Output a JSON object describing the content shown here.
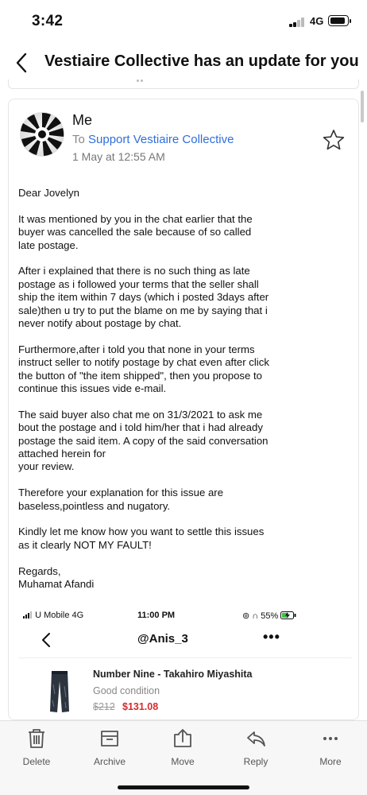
{
  "status_bar": {
    "time": "3:42",
    "network": "4G"
  },
  "header": {
    "title": "Vestiaire Collective has an update for you"
  },
  "email": {
    "sender": "Me",
    "to_prefix": "To",
    "recipient": "Support Vestiaire Collective",
    "date": "1 May at 12:55 AM",
    "paragraphs": [
      "Dear Jovelyn",
      "It was mentioned by you in the chat earlier that the\nbuyer was cancelled the sale because of so called\nlate postage.",
      "After i explained that there is no such thing as late\npostage  as i followed your terms that the seller shall\nship the item within 7 days (which i posted 3days after\nsale)then u try to put the blame on me by saying that i\nnever notify about postage by chat.",
      "Furthermore,after i told you that none in your terms\ninstruct seller to notify postage by chat even after click\nthe button of \"the item shipped\", then you propose to\ncontinue this issues vide e-mail.",
      "The said buyer also chat me on 31/3/2021 to ask me\nbout the postage and i told him/her that i had already\npostage the said item. A copy of the said conversation\nattached herein for\nyour review.",
      "Therefore your explanation for this issue are\nbaseless,pointless and nugatory.",
      "Kindly let me know how you want to settle this issues\nas it clearly NOT MY FAULT!",
      "Regards,\nMuhamat Afandi"
    ]
  },
  "embedded_screenshot": {
    "carrier": "U Mobile  4G",
    "time": "11:00 PM",
    "battery": "55%",
    "chat_title": "@Anis_3",
    "more": "•••",
    "product_name": "Number Nine - Takahiro Miyashita",
    "condition": "Good condition",
    "old_price": "$212",
    "new_price": "$131.08"
  },
  "toolbar": {
    "items": [
      {
        "label": "Delete",
        "icon": "trash-icon"
      },
      {
        "label": "Archive",
        "icon": "archive-icon"
      },
      {
        "label": "Move",
        "icon": "move-icon"
      },
      {
        "label": "Reply",
        "icon": "reply-icon"
      },
      {
        "label": "More",
        "icon": "more-icon"
      }
    ]
  },
  "colors": {
    "link": "#2f6fdb",
    "sale_price": "#d62b2b",
    "toolbar_bg": "#f7f7f7"
  }
}
